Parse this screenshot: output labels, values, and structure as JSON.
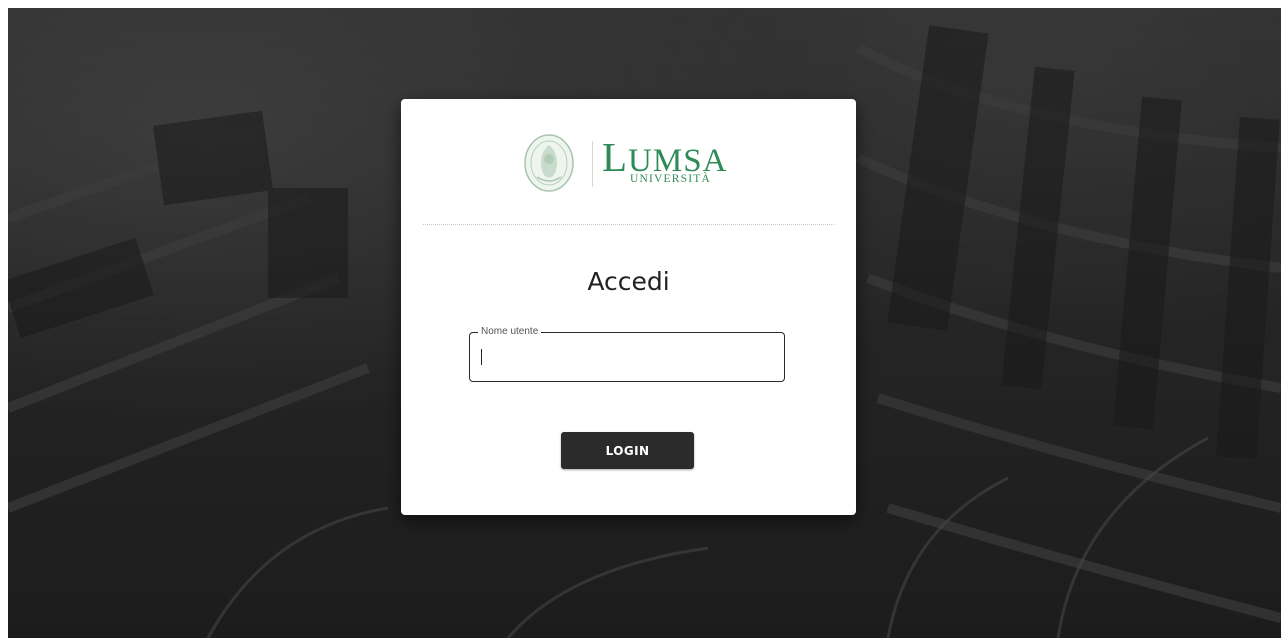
{
  "logo": {
    "brand_initial": "L",
    "brand_rest": "UMSA",
    "subtitle": "UNIVERSITÀ"
  },
  "login": {
    "title": "Accedi",
    "username_label": "Nome utente",
    "username_value": "",
    "button_label": "LOGIN"
  },
  "colors": {
    "brand_green": "#2e8b57",
    "button_bg": "#2b2b2b",
    "background_overlay": "#2f2f2f"
  }
}
